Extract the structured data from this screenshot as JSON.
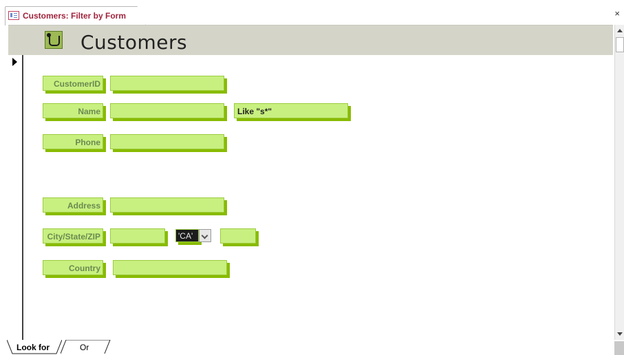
{
  "document_tab": {
    "title": "Customers: Filter by Form",
    "icon": "form-icon"
  },
  "window_controls": {
    "close": "×"
  },
  "form": {
    "title": "Customers",
    "header_icon": "form-logo-icon"
  },
  "fields": {
    "customer_id": {
      "label": "CustomerID",
      "value": ""
    },
    "name": {
      "label": "Name",
      "value": "",
      "criteria": "Like \"s*\""
    },
    "phone": {
      "label": "Phone",
      "value": ""
    },
    "address": {
      "label": "Address",
      "value": ""
    },
    "city_state_zip": {
      "label": "City/State/ZIP",
      "city": "",
      "state": "'CA'",
      "zip": ""
    },
    "country": {
      "label": "Country",
      "value": ""
    }
  },
  "bottom_tabs": {
    "look_for": "Look for",
    "or": "Or"
  },
  "colors": {
    "field_fill": "#c8f080",
    "field_shadow": "#88bb00",
    "label_text": "#6a8a50",
    "tab_title": "#a0243c",
    "header_bg": "#d4d4c8"
  }
}
